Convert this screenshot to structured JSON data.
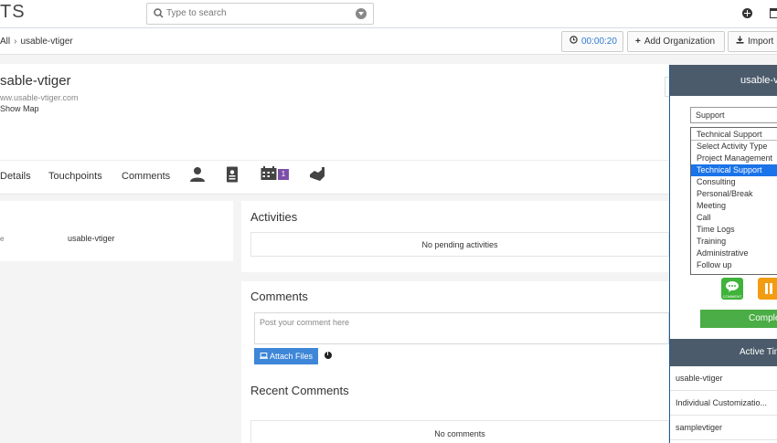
{
  "topbar": {
    "logo_text": "TS",
    "search_placeholder": "Type to search"
  },
  "breadcrumb": {
    "parent": "All",
    "current": "usable-vtiger"
  },
  "toolbar": {
    "timer": "00:00:20",
    "add_org_label": "Add Organization",
    "import_label": "Import"
  },
  "record": {
    "title": "sable-vtiger",
    "website": "ww.usable-vtiger.com",
    "show_map": "Show Map"
  },
  "tabs": {
    "details": "Details",
    "touchpoints": "Touchpoints",
    "comments": "Comments",
    "calendar_badge": "1"
  },
  "left_panel": {
    "field_label": "e",
    "field_value": "usable-vtiger"
  },
  "activities": {
    "title": "Activities",
    "empty": "No pending activities"
  },
  "comments": {
    "title": "Comments",
    "placeholder": "Post your comment here",
    "attach_label": "Attach Files",
    "recent_title": "Recent Comments",
    "empty": "No comments"
  },
  "right_panel": {
    "header": "usable-vti",
    "select_value": "Support",
    "list_value": "Technical Support",
    "options": [
      "Select Activity Type",
      "Project Management",
      "Technical Support",
      "Consulting",
      "Personal/Break",
      "Meeting",
      "Call",
      "Time Logs",
      "Training",
      "Administrative",
      "Follow up"
    ],
    "selected_index": 2,
    "comment_icon_label": "COMMENT",
    "complete_label": "Comple",
    "active_header": "Active Tim",
    "active_items": [
      "usable-vtiger",
      "Individual Customizatio...",
      "samplevtiger"
    ]
  },
  "colors": {
    "accent_blue": "#3e86d8",
    "timer_blue": "#2e7ad1",
    "panel_header": "#4b5b6b",
    "selected_option": "#1a73e8",
    "complete_green": "#4aad45",
    "pause_orange": "#f39c12",
    "badge_purple": "#7c4fa8"
  }
}
